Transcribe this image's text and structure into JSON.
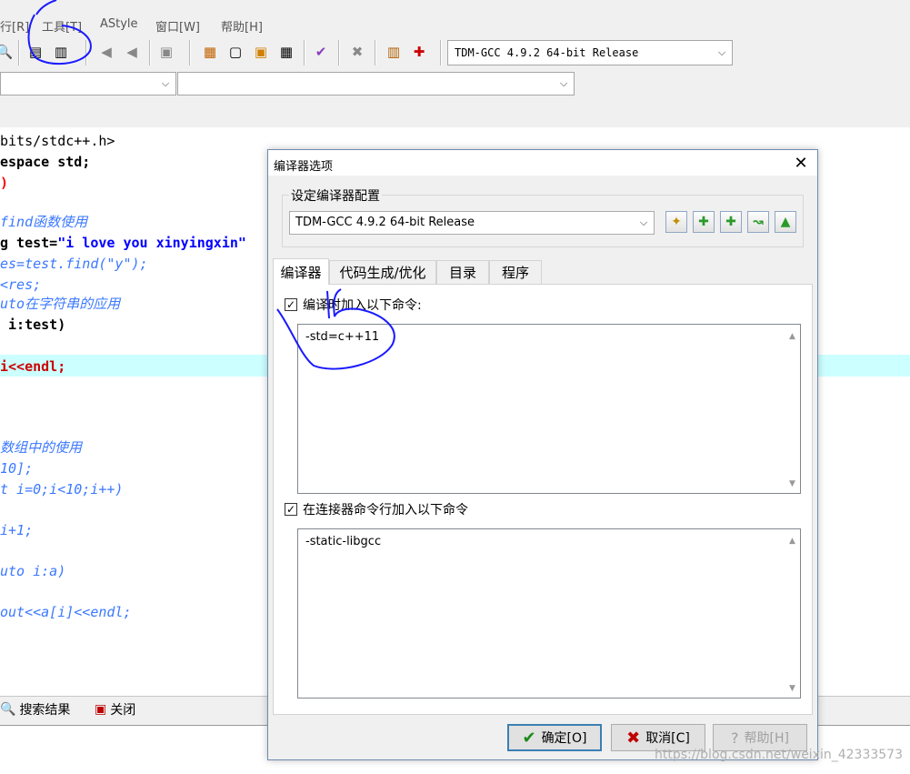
{
  "menu": {
    "run": "行[R]",
    "tools": "工具[T]",
    "astyle": "AStyle",
    "window": "窗口[W]",
    "help": "帮助[H]"
  },
  "toolbar": {
    "compiler_select": "TDM-GCC 4.9.2 64-bit Release"
  },
  "editor": {
    "lines": [
      "bits/stdc++.h>",
      "espace std;",
      ")",
      "",
      "find函数使用",
      "g test=",
      "\"i love you xinyingxin\"",
      "es=test.find(\"y\");",
      "<res;",
      "uto在字符串的应用",
      " i:test)",
      "",
      "i<<endl;",
      "",
      "",
      "",
      "数组中的使用",
      "10];",
      "t i=0;i<10;i++)",
      "",
      "i+1;",
      "",
      "uto i:a)",
      "",
      "out<<a[i]<<endl;"
    ]
  },
  "bottom_tabs": {
    "search": "搜索结果",
    "close": "关闭"
  },
  "dialog": {
    "title": "编译器选项",
    "group_label": "设定编译器配置",
    "config_select": "TDM-GCC 4.9.2 64-bit Release",
    "tabs": [
      "编译器",
      "代码生成/优化",
      "目录",
      "程序"
    ],
    "compile_check_label": "编译时加入以下命令:",
    "compile_commands": "-std=c++11",
    "linker_check_label": "在连接器命令行加入以下命令",
    "linker_commands": "-static-libgcc",
    "ok_label": "确定[O]",
    "cancel_label": "取消[C]",
    "help_label": "帮助[H]"
  },
  "watermark": "https://blog.csdn.net/weixin_42333573",
  "colors": {
    "highlight_line": "#ccffff",
    "comment": "#3b78ff",
    "string": "#0000ff",
    "annotation": "#1a1aff"
  }
}
